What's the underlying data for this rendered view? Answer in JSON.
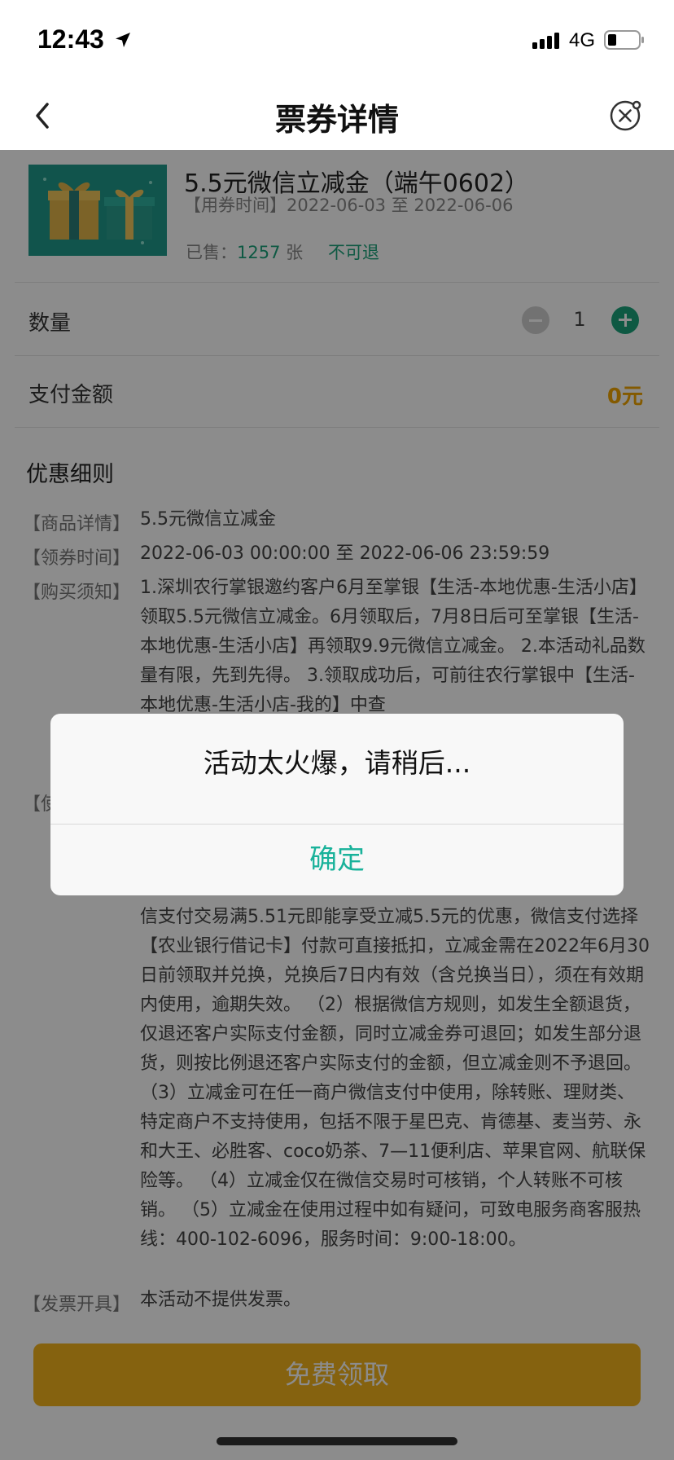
{
  "status_bar": {
    "time": "12:43",
    "network": "4G"
  },
  "nav": {
    "title": "票券详情"
  },
  "product": {
    "title": "5.5元微信立减金（端午0602）",
    "use_time": "【用券时间】2022-06-03 至 2022-06-06",
    "sold_prefix": "已售：",
    "sold_count": "1257",
    "sold_suffix": " 张",
    "refund": "不可退"
  },
  "quantity": {
    "label": "数量",
    "value": "1"
  },
  "payment": {
    "label": "支付金额",
    "value": "0元"
  },
  "details": {
    "title": "优惠细则",
    "rows": [
      {
        "label": "【商品详情】",
        "text": "5.5元微信立减金"
      },
      {
        "label": "【领券时间】",
        "text": "2022-06-03 00:00:00 至 2022-06-06 23:59:59"
      },
      {
        "label": "【购买须知】",
        "text": "1.深圳农行掌银邀约客户6月至掌银【生活-本地优惠-生活小店】领取5.5元微信立减金。6月领取后，7月8日后可至掌银【生活-本地优惠-生活小店】再领取9.9元微信立减金。 2.本活动礼品数量有限，先到先得。 3.领取成功后，可前往农行掌银中【生活-本地优惠-生活小店-我的】中查"
      },
      {
        "label": "【使",
        "text": "信支付交易满5.51元即能享受立减5.5元的优惠，微信支付选择【农业银行借记卡】付款可直接抵扣，立减金需在2022年6月30日前领取并兑换，兑换后7日内有效（含兑换当日），须在有效期内使用，逾期失效。 （2）根据微信方规则，如发生全额退货，仅退还客户实际支付金额，同时立减金券可退回；如发生部分退货，则按比例退还客户实际支付的金额，但立减金则不予退回。 （3）立减金可在任一商户微信支付中使用，除转账、理财类、特定商户不支持使用，包括不限于星巴克、肯德基、麦当劳、永和大王、必胜客、coco奶茶、7—11便利店、苹果官网、航联保险等。 （4）立减金仅在微信交易时可核销，个人转账不可核销。 （5）立减金在使用过程中如有疑问，可致电服务商客服热线：400-102-6096，服务时间：9:00-18:00。"
      },
      {
        "label": "【发票开具】",
        "text": "本活动不提供发票。"
      }
    ]
  },
  "claim_button": "免费领取",
  "modal": {
    "message": "活动太火爆，请稍后...",
    "confirm": "确定"
  }
}
